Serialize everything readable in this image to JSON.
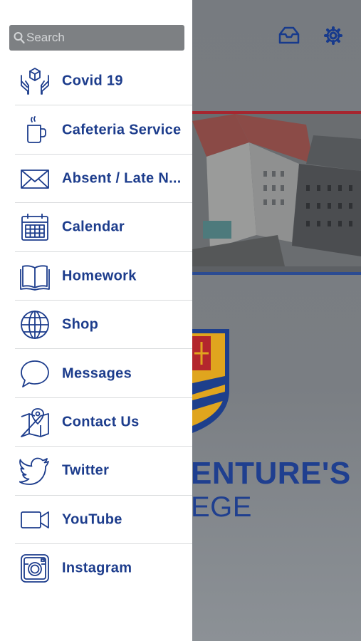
{
  "search": {
    "placeholder": "Search"
  },
  "menu": {
    "items": [
      {
        "label": "Covid 19",
        "icon": "hands-box-icon"
      },
      {
        "label": "Cafeteria Service",
        "icon": "coffee-cup-icon"
      },
      {
        "label": "Absent / Late N...",
        "icon": "envelope-icon"
      },
      {
        "label": "Calendar",
        "icon": "calendar-icon"
      },
      {
        "label": "Homework",
        "icon": "book-icon"
      },
      {
        "label": "Shop",
        "icon": "globe-icon"
      },
      {
        "label": "Messages",
        "icon": "chat-bubble-icon"
      },
      {
        "label": "Contact Us",
        "icon": "map-pin-icon"
      },
      {
        "label": "Twitter",
        "icon": "twitter-bird-icon"
      },
      {
        "label": "YouTube",
        "icon": "video-camera-icon"
      },
      {
        "label": "Instagram",
        "icon": "instagram-icon"
      }
    ]
  },
  "background": {
    "title_line1": "ENTURE'S",
    "title_line2": "EGE"
  },
  "colors": {
    "accent": "#1c3c8c",
    "crest_gold": "#e0a51e",
    "crest_red": "#b3262d"
  }
}
